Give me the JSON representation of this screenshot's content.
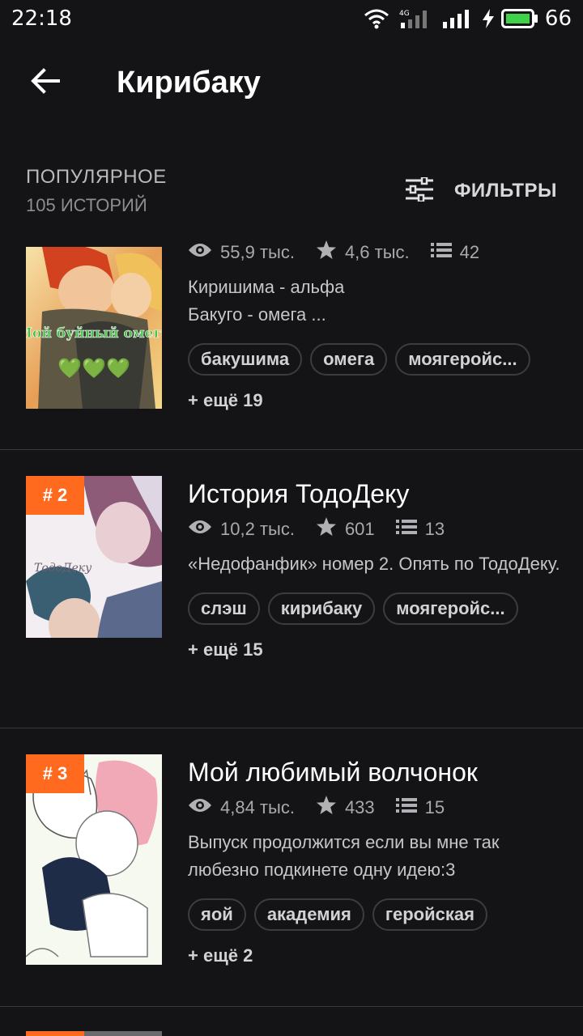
{
  "status_bar": {
    "time": "22:18",
    "network": "4G",
    "battery": "66",
    "icons": [
      "wifi-icon",
      "signal-4g-icon",
      "signal-icon",
      "charging-icon",
      "battery-icon"
    ]
  },
  "header": {
    "title": "Кирибаку",
    "back_icon": "arrow-left-icon"
  },
  "section": {
    "title": "ПОПУЛЯРНОЕ",
    "count": "105 ИСТОРИЙ",
    "filters_label": "ФИЛЬТРЫ",
    "filters_icon": "sliders-icon"
  },
  "colors": {
    "background": "#141416",
    "accent": "#ff6a1f",
    "tag_border": "#3c3c40"
  },
  "stories": [
    {
      "rank": "",
      "title": "",
      "cover_text": "Мой буйный омега",
      "cover_emoji": "💚💚💚",
      "views": "55,9 тыс.",
      "votes": "4,6 тыс.",
      "parts": "42",
      "description": "Киришима - альфа\nБакуго - омега ...",
      "tags": [
        "бакушима",
        "омега",
        "моягеройс..."
      ],
      "more": "+ ещё 19"
    },
    {
      "rank": "# 2",
      "title": "История ТодоДеку",
      "cover_text": "ТодоДеку",
      "views": "10,2 тыс.",
      "votes": "601",
      "parts": "13",
      "description": "«Недофанфик» номер 2. Опять по ТодоДеку.",
      "tags": [
        "слэш",
        "кирибаку",
        "моягеройс..."
      ],
      "more": "+ ещё 15"
    },
    {
      "rank": "# 3",
      "title": "Мой любимый волчонок",
      "views": "4,84 тыс.",
      "votes": "433",
      "parts": "15",
      "description": "Выпуск продолжится если вы мне так любезно подкинете одну идею:3",
      "tags": [
        "яой",
        "академия",
        "геройская"
      ],
      "more": "+ ещё 2"
    }
  ]
}
